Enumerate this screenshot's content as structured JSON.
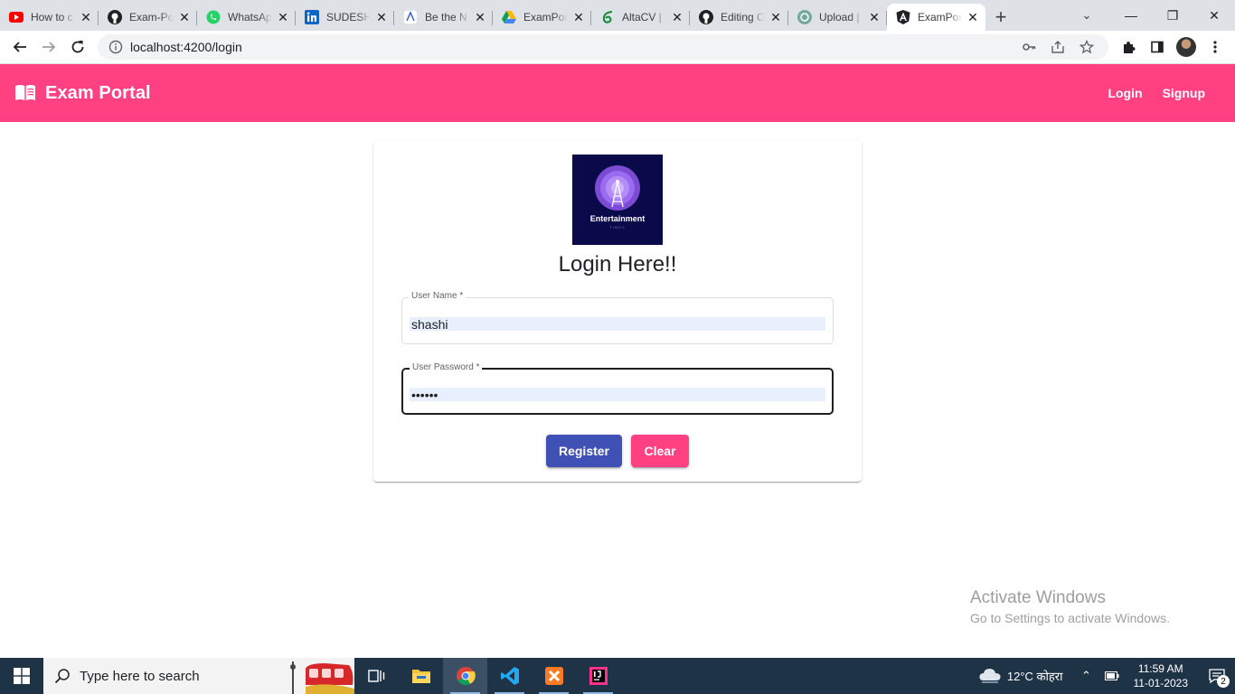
{
  "browser": {
    "tabs": [
      {
        "title": "How to c",
        "icon": "youtube-icon"
      },
      {
        "title": "Exam-Po",
        "icon": "github-icon"
      },
      {
        "title": "WhatsAp",
        "icon": "whatsapp-icon"
      },
      {
        "title": "SUDESH",
        "icon": "linkedin-icon"
      },
      {
        "title": "Be the N",
        "icon": "site-icon"
      },
      {
        "title": "ExamPor",
        "icon": "google-drive-icon"
      },
      {
        "title": "AltaCV |",
        "icon": "overleaf-icon"
      },
      {
        "title": "Editing C",
        "icon": "github-icon"
      },
      {
        "title": "Upload |",
        "icon": "openai-icon"
      },
      {
        "title": "ExamPor",
        "icon": "angular-icon"
      }
    ],
    "url": "localhost:4200/login",
    "new_tab_label": "+"
  },
  "navbar": {
    "brand": "Exam Portal",
    "links": [
      "Login",
      "Signup"
    ]
  },
  "login": {
    "logo_text": "Entertainment",
    "logo_subtext": "TIMES",
    "title": "Login Here!!",
    "username_label": "User Name *",
    "username_value": "shashi",
    "password_label": "User Password *",
    "password_value": "shashi",
    "register_label": "Register",
    "clear_label": "Clear"
  },
  "watermark": {
    "line1": "Activate Windows",
    "line2": "Go to Settings to activate Windows."
  },
  "taskbar": {
    "search_placeholder": "Type here to search",
    "weather": "12°C  कोहरा",
    "time": "11:59 AM",
    "date": "11-01-2023",
    "notification_count": "2"
  }
}
